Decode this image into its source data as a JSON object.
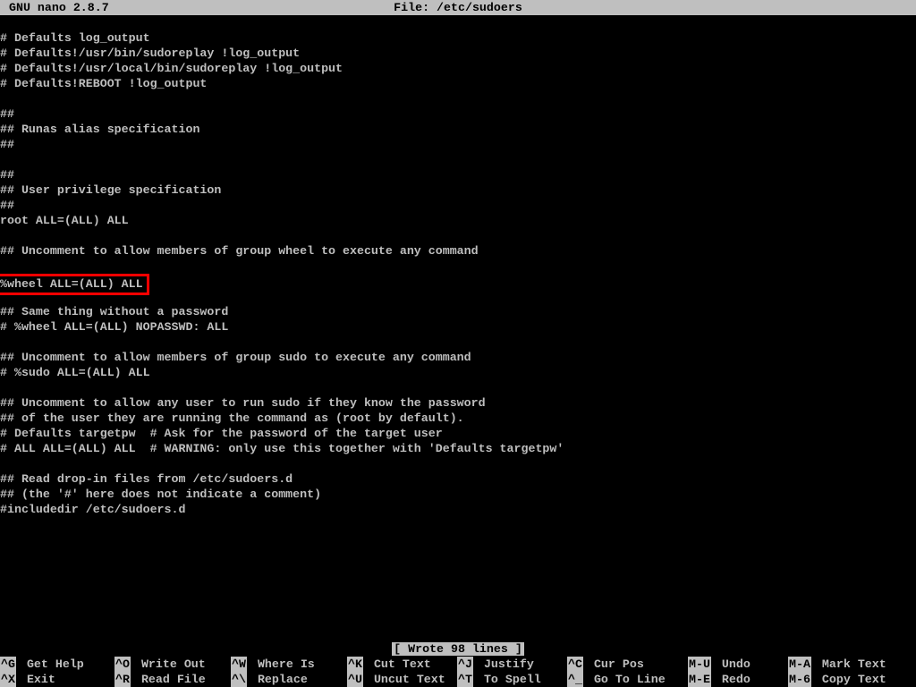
{
  "title": {
    "app": "GNU nano 2.8.7",
    "file": "File: /etc/sudoers"
  },
  "lines": [
    "",
    "# Defaults log_output",
    "# Defaults!/usr/bin/sudoreplay !log_output",
    "# Defaults!/usr/local/bin/sudoreplay !log_output",
    "# Defaults!REBOOT !log_output",
    "",
    "##",
    "## Runas alias specification",
    "##",
    "",
    "##",
    "## User privilege specification",
    "##",
    "root ALL=(ALL) ALL",
    "",
    "## Uncomment to allow members of group wheel to execute any command",
    "",
    "%wheel ALL=(ALL) ALL",
    "",
    "## Same thing without a password",
    "# %wheel ALL=(ALL) NOPASSWD: ALL",
    "",
    "## Uncomment to allow members of group sudo to execute any command",
    "# %sudo ALL=(ALL) ALL",
    "",
    "## Uncomment to allow any user to run sudo if they know the password",
    "## of the user they are running the command as (root by default).",
    "# Defaults targetpw  # Ask for the password of the target user",
    "# ALL ALL=(ALL) ALL  # WARNING: only use this together with 'Defaults targetpw'",
    "",
    "## Read drop-in files from /etc/sudoers.d",
    "## (the '#' here does not indicate a comment)",
    "#includedir /etc/sudoers.d"
  ],
  "highlight_index": 17,
  "status": "[ Wrote 98 lines ]",
  "footer": {
    "row1": [
      {
        "key": "^G",
        "label": "Get Help"
      },
      {
        "key": "^O",
        "label": "Write Out"
      },
      {
        "key": "^W",
        "label": "Where Is"
      },
      {
        "key": "^K",
        "label": "Cut Text"
      },
      {
        "key": "^J",
        "label": "Justify"
      },
      {
        "key": "^C",
        "label": "Cur Pos"
      },
      {
        "key": "M-U",
        "label": "Undo"
      },
      {
        "key": "M-A",
        "label": "Mark Text"
      }
    ],
    "row2": [
      {
        "key": "^X",
        "label": "Exit"
      },
      {
        "key": "^R",
        "label": "Read File"
      },
      {
        "key": "^\\",
        "label": "Replace"
      },
      {
        "key": "^U",
        "label": "Uncut Text"
      },
      {
        "key": "^T",
        "label": "To Spell"
      },
      {
        "key": "^_",
        "label": "Go To Line"
      },
      {
        "key": "M-E",
        "label": "Redo"
      },
      {
        "key": "M-6",
        "label": "Copy Text"
      }
    ]
  }
}
